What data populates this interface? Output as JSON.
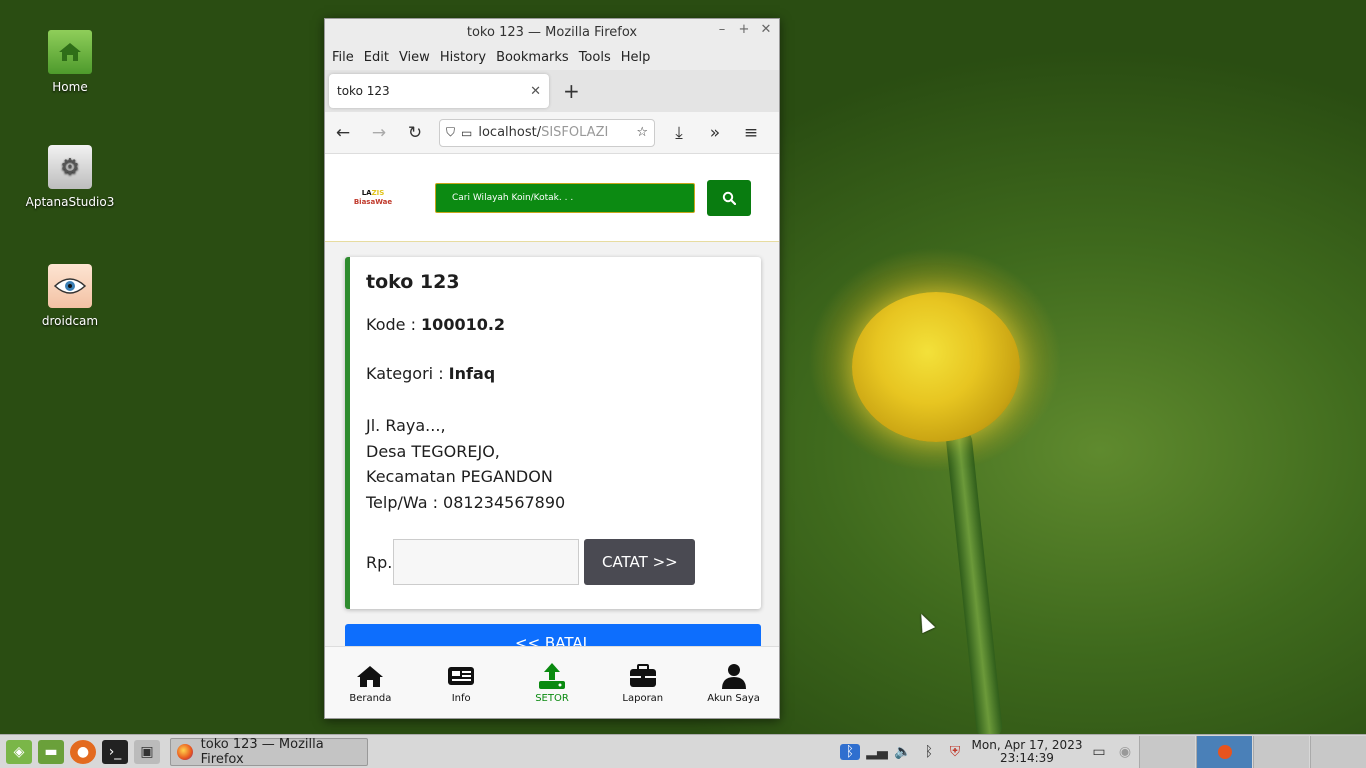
{
  "desktop": {
    "icons": [
      {
        "label": "Home"
      },
      {
        "label": "AptanaStudio3"
      },
      {
        "label": "droidcam"
      }
    ]
  },
  "browser": {
    "window_title": "toko 123 — Mozilla Firefox",
    "menu": [
      "File",
      "Edit",
      "View",
      "History",
      "Bookmarks",
      "Tools",
      "Help"
    ],
    "tab_title": "toko 123",
    "url_host": "localhost/",
    "url_path": "SISFOLAZI"
  },
  "site": {
    "logo_line1_a": "LA",
    "logo_line1_b": "ZIS",
    "logo_line2": "BiasaWae",
    "search_placeholder": "Cari Wilayah Koin/Kotak. . ."
  },
  "card": {
    "title": "toko 123",
    "kode_label": "Kode : ",
    "kode_value": "100010.2",
    "kategori_label": "Kategori : ",
    "kategori_value": "Infaq",
    "address": [
      "Jl. Raya...,",
      "Desa TEGOREJO,",
      "Kecamatan PEGANDON",
      "Telp/Wa : 081234567890"
    ],
    "rp_label": "Rp.",
    "amount_value": "",
    "catat_label": "CATAT >>"
  },
  "batal_label": "<< BATAL",
  "bottom_nav": [
    {
      "label": "Beranda",
      "icon": "home-icon"
    },
    {
      "label": "Info",
      "icon": "newspaper-icon"
    },
    {
      "label": "SETOR",
      "icon": "upload-icon"
    },
    {
      "label": "Laporan",
      "icon": "briefcase-icon"
    },
    {
      "label": "Akun Saya",
      "icon": "user-icon"
    }
  ],
  "taskbar": {
    "window_button": "toko 123 — Mozilla Firefox",
    "clock_date": "Mon, Apr 17, 2023",
    "clock_time": "23:14:39"
  },
  "colors": {
    "site_green": "#097c10",
    "card_border": "#2e8b2e",
    "batal_blue": "#0d6efd",
    "catat_gray": "#4a4a52"
  }
}
